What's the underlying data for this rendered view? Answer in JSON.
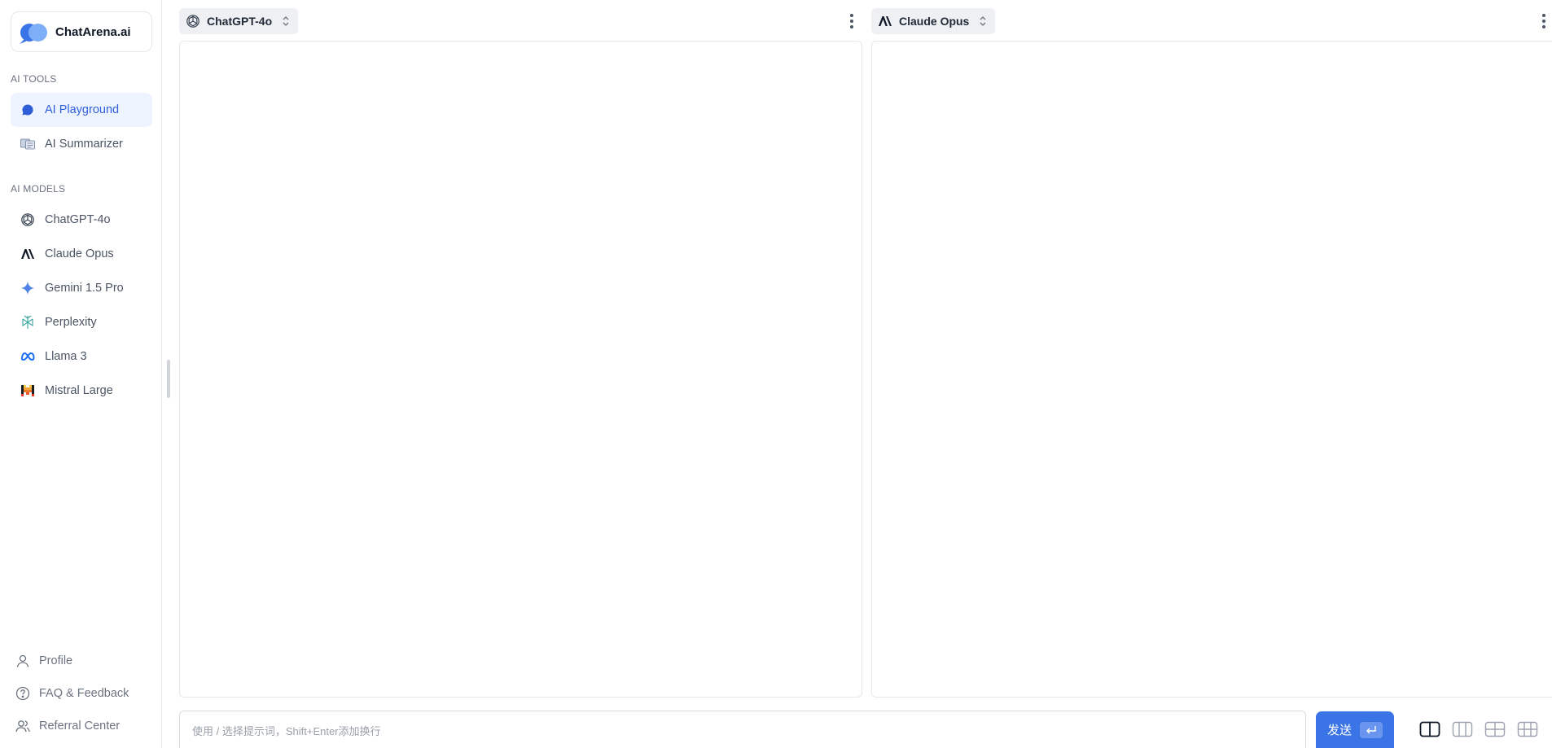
{
  "brand": {
    "name": "ChatArena.ai"
  },
  "sidebar": {
    "sections": [
      {
        "title": "AI TOOLS",
        "items": [
          {
            "label": "AI Playground",
            "icon": "chat-bubble-icon",
            "active": true
          },
          {
            "label": "AI Summarizer",
            "icon": "summarizer-icon",
            "active": false
          }
        ]
      },
      {
        "title": "AI MODELS",
        "items": [
          {
            "label": "ChatGPT-4o",
            "icon": "openai-icon"
          },
          {
            "label": "Claude Opus",
            "icon": "anthropic-icon"
          },
          {
            "label": "Gemini 1.5 Pro",
            "icon": "gemini-icon"
          },
          {
            "label": "Perplexity",
            "icon": "perplexity-icon"
          },
          {
            "label": "Llama 3",
            "icon": "meta-icon"
          },
          {
            "label": "Mistral Large",
            "icon": "mistral-icon"
          }
        ]
      }
    ],
    "bottom": [
      {
        "label": "Profile",
        "icon": "user-icon"
      },
      {
        "label": "FAQ & Feedback",
        "icon": "help-circle-icon"
      },
      {
        "label": "Referral Center",
        "icon": "users-icon"
      }
    ]
  },
  "panels": [
    {
      "model": "ChatGPT-4o",
      "icon": "openai-icon"
    },
    {
      "model": "Claude Opus",
      "icon": "anthropic-icon"
    }
  ],
  "input": {
    "placeholder": "使用 / 选择提示词，Shift+Enter添加换行",
    "value": ""
  },
  "send": {
    "label": "发送",
    "icon": "enter-key-icon"
  },
  "layout_options": [
    "two-column",
    "three-column",
    "four-grid",
    "six-grid"
  ],
  "colors": {
    "accent": "#3b74e6",
    "active_bg": "#eef4ff",
    "active_text": "#2f5fd8",
    "border": "#e5e7eb"
  }
}
